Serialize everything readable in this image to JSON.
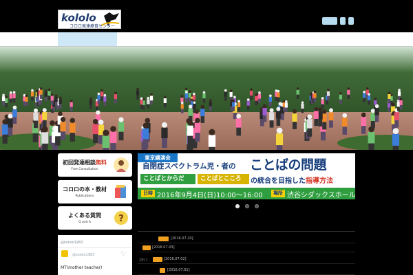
{
  "header": {
    "logo_text": "kololo",
    "logo_sub": "コロロ発達療育センター"
  },
  "sidebar": {
    "cards": [
      {
        "title_a": "初回発達相談",
        "title_b": "無料",
        "subtitle": "Free Consultation",
        "icon": "counselor-icon"
      },
      {
        "title_a": "コロロの本・教材",
        "title_b": "",
        "subtitle": "Publications",
        "icon": "books-icon"
      },
      {
        "title_a": "よくある質問",
        "title_b": "",
        "subtitle": "Q and A",
        "icon": "question-icon"
      }
    ]
  },
  "twitter": {
    "handle": "@kololo1983",
    "account_name": "@kololo1983",
    "tweet": "MT(mother teacher)"
  },
  "banner": {
    "tag": "東京講演会",
    "subtitle": "自閉症スペクトラム児・者の",
    "main_title": "ことばの問題",
    "pill1": "ことばとからだ",
    "pill2": "ことばとこころ",
    "goal_a": "の統合を目指した",
    "goal_b": "指導方法",
    "date_label": "日時",
    "date": "2016年9月4日(日)10:00～16:00",
    "venue_label": "場所",
    "venue": "渋谷シダックスホール"
  },
  "slider": {
    "count": 3,
    "active": 0
  },
  "news": [
    {
      "prefix": "",
      "date": "[2016.07.20]"
    },
    {
      "prefix": "",
      "date": "[2016.07.03]"
    },
    {
      "prefix": "ｽﾀｯﾌ",
      "date": "[2016.07.02]"
    },
    {
      "prefix": "",
      "date": "[2016.07.01]"
    }
  ],
  "colors": {
    "accent_blue": "#1976c6",
    "green": "#2f9e3f",
    "yellow": "#f5d000",
    "orange_tag": "#f0a020",
    "navy_text": "#173e7c",
    "red_text": "#d63b2a"
  }
}
